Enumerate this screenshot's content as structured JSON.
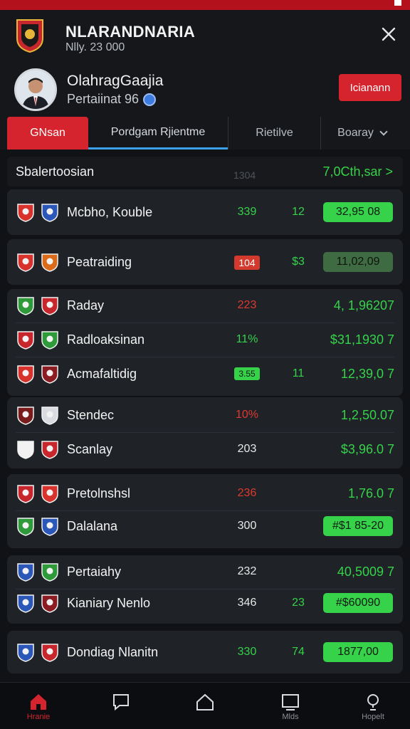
{
  "header": {
    "title": "NLARANDNARIA",
    "subtitle": "Nlly. 23 000"
  },
  "profile": {
    "name": "OlahragGaajia",
    "subtitle": "Pertaiinat 96",
    "button": "Icianann"
  },
  "tabs": [
    {
      "label": "GNsan",
      "active": true
    },
    {
      "label": "Pordgam Rjientme"
    },
    {
      "label": "Rietilve"
    },
    {
      "label": "Boaray"
    }
  ],
  "section": {
    "title": "Sbalertoosian",
    "count": "1304",
    "link": "7,0Cth,sar >"
  },
  "cards": [
    {
      "rows": [
        {
          "name": "Mcbho, Kouble",
          "c1": "339",
          "c2": "12",
          "price": "32,95 08",
          "pill": "bright"
        }
      ]
    },
    {
      "rows": [
        {
          "name": "Peatraiding",
          "c1": "104",
          "c1_tag": "red",
          "c2": "$3",
          "price": "11,02,09",
          "pill": "dark"
        }
      ]
    },
    {
      "rows": [
        {
          "name": "Raday",
          "c1": "223",
          "c1_color": "red",
          "c2": "",
          "price": "4, 1,96207"
        },
        {
          "name": "Radloaksinan",
          "c1": "11%",
          "c1_color": "green",
          "c2": "",
          "price": "$31,1930 7"
        },
        {
          "name": "Acmafaltidig",
          "c1": "3.55",
          "c1_tag": "green",
          "c2": "11",
          "price": "12,39,0 7"
        }
      ]
    },
    {
      "rows": [
        {
          "name": "Stendec",
          "c1": "10%",
          "c1_color": "red",
          "c2": "",
          "price": "1,2,50.07"
        },
        {
          "name": "Scanlay",
          "c1": "203",
          "c1_color": "white",
          "c2": "",
          "price": "$3,96.0 7"
        }
      ]
    },
    {
      "rows": [
        {
          "name": "Pretolnshsl",
          "c1": "236",
          "c1_color": "red",
          "c2": "",
          "price": "1,76.0 7"
        },
        {
          "name": "Dalalana",
          "c1": "300",
          "c1_color": "white",
          "c2": "",
          "price": "#$1 85-20",
          "pill": "bright"
        }
      ]
    },
    {
      "rows": [
        {
          "name": "Pertaiahy",
          "c1": "232",
          "c1_color": "white",
          "c2": "",
          "price": "40,5009 7"
        },
        {
          "name": "Kianiary Nenlo",
          "c1": "346",
          "c1_color": "white",
          "c2": "23",
          "price": "#$60090",
          "pill": "bright"
        }
      ]
    },
    {
      "rows": [
        {
          "name": "Dondiag Nlanitn",
          "c1": "330",
          "c1_color": "green",
          "c2": "74",
          "price": "1877,00",
          "pill": "bright"
        }
      ]
    }
  ],
  "nav": [
    {
      "label": "Hranie",
      "icon": "home-icon",
      "active": true
    },
    {
      "label": "",
      "icon": "chat-icon"
    },
    {
      "label": "",
      "icon": "house-outline-icon"
    },
    {
      "label": "Mlds",
      "icon": "screen-icon"
    },
    {
      "label": "Hopelt",
      "icon": "help-icon"
    }
  ],
  "colors": {
    "accent": "#d5242e",
    "positive": "#35d24a",
    "background": "#101216"
  }
}
